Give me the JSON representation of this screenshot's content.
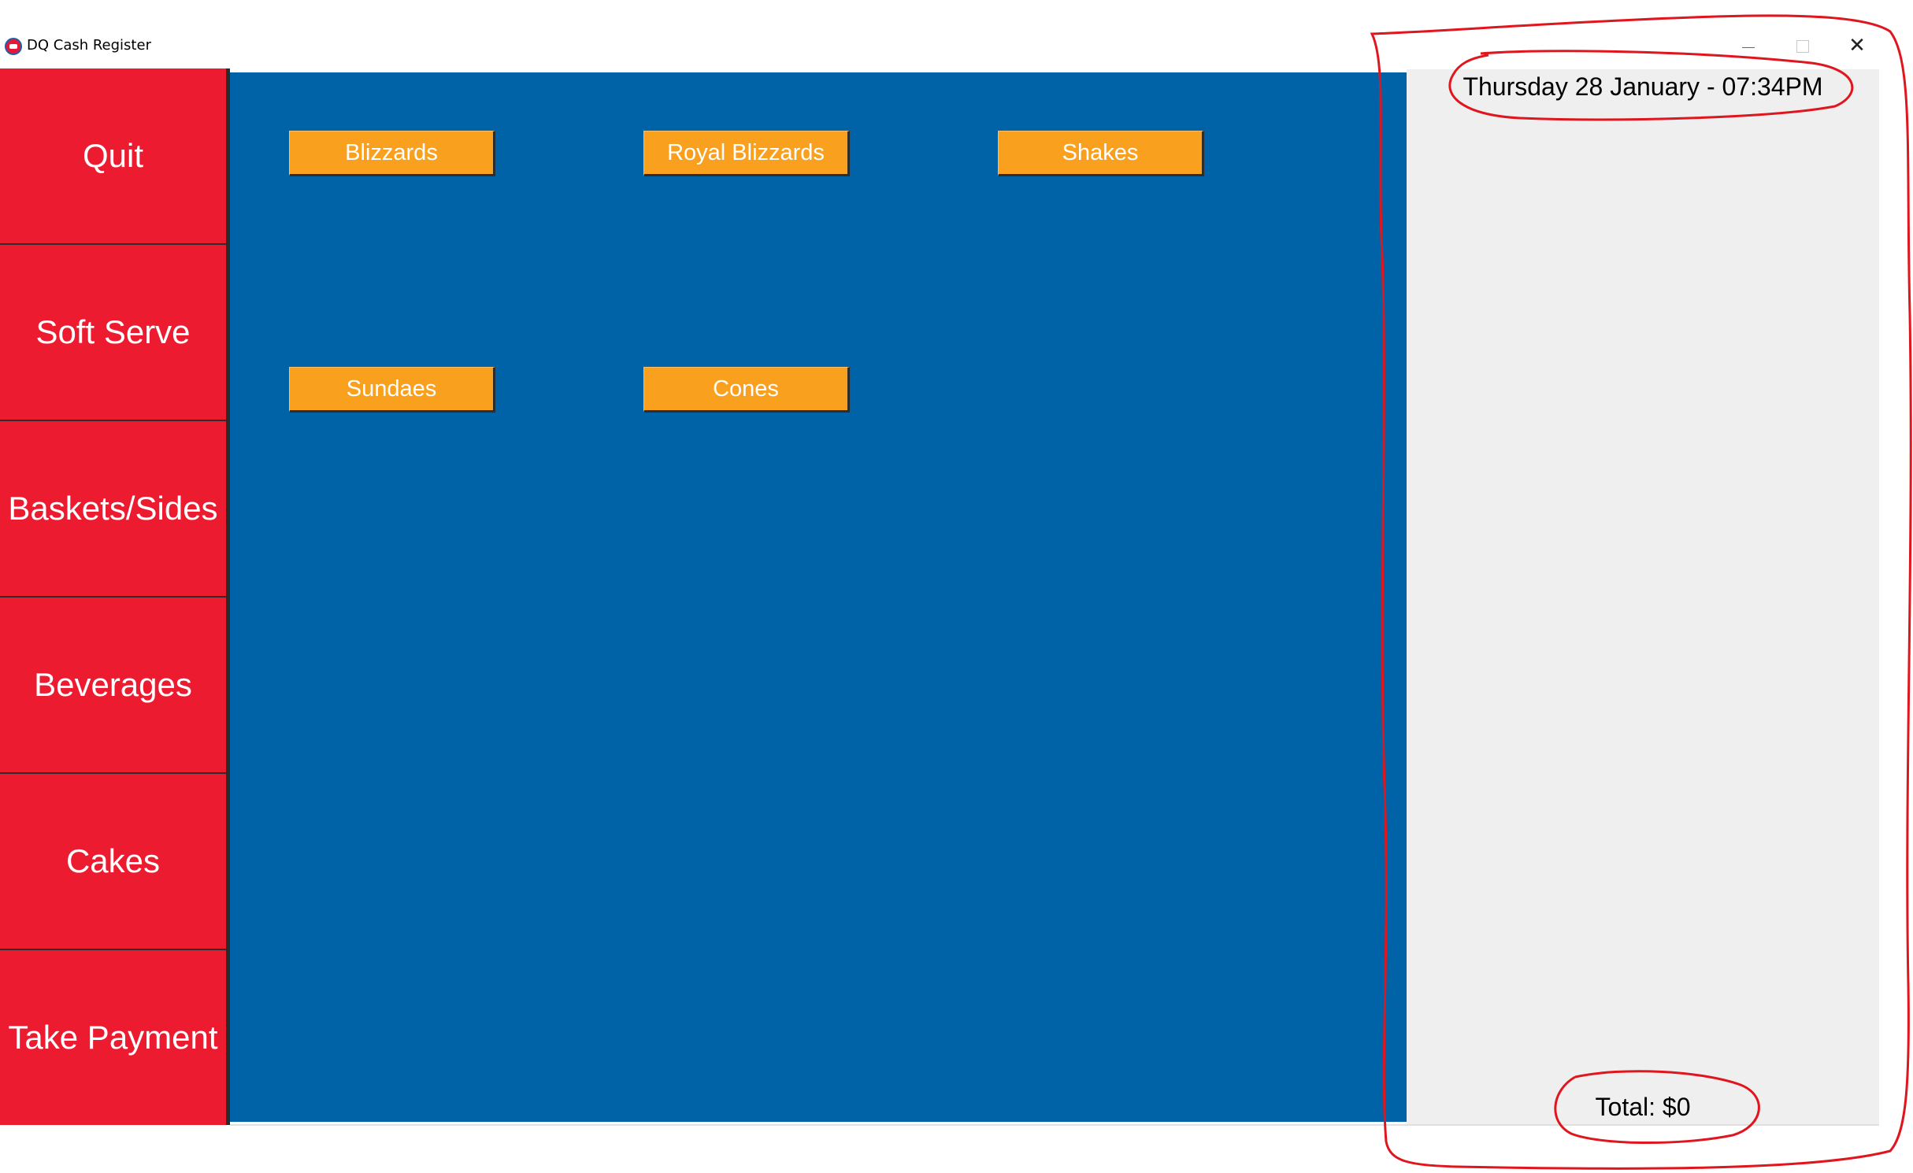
{
  "window": {
    "title": "DQ Cash Register",
    "controls": {
      "minimize_icon": "minimize-icon",
      "maximize_icon": "maximize-icon",
      "close_icon": "close-icon",
      "close_glyph": "✕"
    }
  },
  "categories": [
    {
      "label": "Quit"
    },
    {
      "label": "Soft Serve"
    },
    {
      "label": "Baskets/Sides"
    },
    {
      "label": "Beverages"
    },
    {
      "label": "Cakes"
    },
    {
      "label": "Take Payment"
    }
  ],
  "menu_items": [
    {
      "label": "Blizzards"
    },
    {
      "label": "Royal Blizzards"
    },
    {
      "label": "Shakes"
    },
    {
      "label": "Sundaes"
    },
    {
      "label": "Cones"
    }
  ],
  "order_panel": {
    "datetime": "Thursday 28 January - 07:34PM",
    "total": "Total: $0"
  },
  "colors": {
    "category_red": "#ec1b30",
    "menu_blue": "#0063a8",
    "item_orange": "#f9a01f",
    "panel_gray": "#efefef",
    "annotation_red": "#e0161e"
  }
}
